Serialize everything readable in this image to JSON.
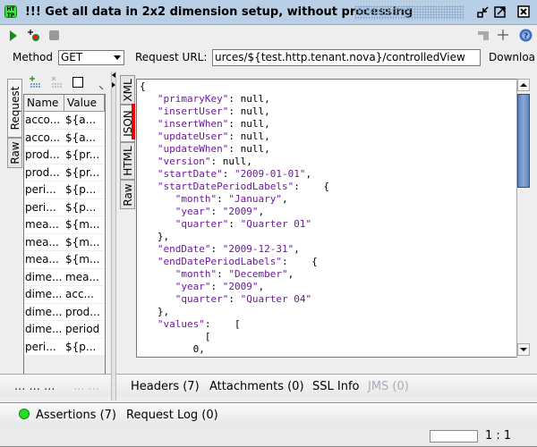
{
  "window": {
    "title": "!!! Get all data in 2x2 dimension setup,  without processing",
    "logo_text": "HT TP",
    "controls": [
      "minimize-icon",
      "maximize-icon",
      "close-icon"
    ]
  },
  "toolbar": {
    "left_icons": [
      "play-icon",
      "add-assertion-icon",
      "stop-icon"
    ],
    "right_icons": [
      "tile-icon",
      "plus-icon",
      "help-icon"
    ]
  },
  "request": {
    "method_label": "Method",
    "method_value": "GET",
    "url_label": "Request URL:",
    "url_value": "urces/${test.http.tenant.nova}/controlledView",
    "download_label": "Downloa"
  },
  "left_tabs": [
    "Request",
    "Raw"
  ],
  "params_table": {
    "columns": [
      "Name",
      "Value"
    ],
    "rows": [
      [
        "acco...",
        "${a..."
      ],
      [
        "acco...",
        "${a..."
      ],
      [
        "prod...",
        "${pr..."
      ],
      [
        "prod...",
        "${pr..."
      ],
      [
        "peri...",
        "${p..."
      ],
      [
        "peri...",
        "${p..."
      ],
      [
        "mea...",
        "${m..."
      ],
      [
        "mea...",
        "${m..."
      ],
      [
        "mea...",
        "${m..."
      ],
      [
        "dime...",
        "mea..."
      ],
      [
        "dime...",
        "acc..."
      ],
      [
        "dime...",
        "prod..."
      ],
      [
        "dime...",
        "period"
      ],
      [
        "peri...",
        "${p..."
      ]
    ]
  },
  "left_bottom_text": "... ... ...",
  "left_bottom_text_dim": "... ...",
  "response_tabs": [
    "XML",
    "JSON",
    "HTML",
    "Raw"
  ],
  "response_lines": [
    [
      [
        "p",
        "{"
      ]
    ],
    [
      [
        "p",
        "   "
      ],
      [
        "k",
        "\"primaryKey\""
      ],
      [
        "p",
        ": null,"
      ]
    ],
    [
      [
        "p",
        "   "
      ],
      [
        "k",
        "\"insertUser\""
      ],
      [
        "p",
        ": null,"
      ]
    ],
    [
      [
        "p",
        "   "
      ],
      [
        "k",
        "\"insertWhen\""
      ],
      [
        "p",
        ": null,"
      ]
    ],
    [
      [
        "p",
        "   "
      ],
      [
        "k",
        "\"updateUser\""
      ],
      [
        "p",
        ": null,"
      ]
    ],
    [
      [
        "p",
        "   "
      ],
      [
        "k",
        "\"updateWhen\""
      ],
      [
        "p",
        ": null,"
      ]
    ],
    [
      [
        "p",
        "   "
      ],
      [
        "k",
        "\"version\""
      ],
      [
        "p",
        ": null,"
      ]
    ],
    [
      [
        "p",
        "   "
      ],
      [
        "k",
        "\"startDate\""
      ],
      [
        "p",
        ": "
      ],
      [
        "k",
        "\"2009-01-01\""
      ],
      [
        "p",
        ","
      ]
    ],
    [
      [
        "p",
        "   "
      ],
      [
        "k",
        "\"startDatePeriodLabels\""
      ],
      [
        "p",
        ":    {"
      ]
    ],
    [
      [
        "p",
        "      "
      ],
      [
        "k",
        "\"month\""
      ],
      [
        "p",
        ": "
      ],
      [
        "k",
        "\"January\""
      ],
      [
        "p",
        ","
      ]
    ],
    [
      [
        "p",
        "      "
      ],
      [
        "k",
        "\"year\""
      ],
      [
        "p",
        ": "
      ],
      [
        "k",
        "\"2009\""
      ],
      [
        "p",
        ","
      ]
    ],
    [
      [
        "p",
        "      "
      ],
      [
        "k",
        "\"quarter\""
      ],
      [
        "p",
        ": "
      ],
      [
        "k",
        "\"Quarter 01\""
      ]
    ],
    [
      [
        "p",
        "   },"
      ]
    ],
    [
      [
        "p",
        "   "
      ],
      [
        "k",
        "\"endDate\""
      ],
      [
        "p",
        ": "
      ],
      [
        "k",
        "\"2009-12-31\""
      ],
      [
        "p",
        ","
      ]
    ],
    [
      [
        "p",
        "   "
      ],
      [
        "k",
        "\"endDatePeriodLabels\""
      ],
      [
        "p",
        ":    {"
      ]
    ],
    [
      [
        "p",
        "      "
      ],
      [
        "k",
        "\"month\""
      ],
      [
        "p",
        ": "
      ],
      [
        "k",
        "\"December\""
      ],
      [
        "p",
        ","
      ]
    ],
    [
      [
        "p",
        "      "
      ],
      [
        "k",
        "\"year\""
      ],
      [
        "p",
        ": "
      ],
      [
        "k",
        "\"2009\""
      ],
      [
        "p",
        ","
      ]
    ],
    [
      [
        "p",
        "      "
      ],
      [
        "k",
        "\"quarter\""
      ],
      [
        "p",
        ": "
      ],
      [
        "k",
        "\"Quarter 04\""
      ]
    ],
    [
      [
        "p",
        "   },"
      ]
    ],
    [
      [
        "p",
        "   "
      ],
      [
        "k",
        "\"values\""
      ],
      [
        "p",
        ":    ["
      ]
    ],
    [
      [
        "p",
        "           ["
      ]
    ],
    [
      [
        "p",
        "         0,"
      ]
    ]
  ],
  "bottom_tabs": {
    "headers": "Headers (7)",
    "attachments": "Attachments (0)",
    "ssl": "SSL Info",
    "jms": "JMS (0)"
  },
  "assertions": {
    "label": "Assertions (7)",
    "status_color": "#22dd22",
    "request_log": "Request Log (0)"
  },
  "status": {
    "position": "1 : 1"
  },
  "colors": {
    "title_bg": "#b8cfe5",
    "json_key": "#6a1b9a",
    "active_tab_marker": "#ee0000"
  }
}
